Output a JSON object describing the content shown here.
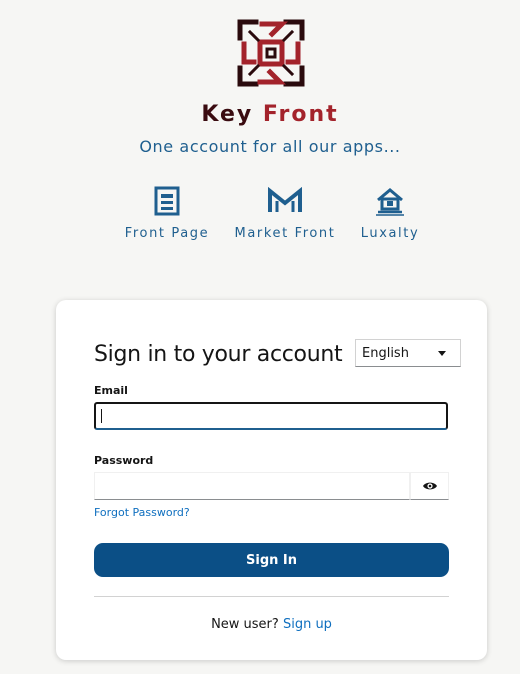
{
  "brand": {
    "name_part1": "Key",
    "name_part2": "Front",
    "tagline": "One account for all our apps..."
  },
  "apps": [
    {
      "label": "Front Page",
      "icon": "newspaper-icon"
    },
    {
      "label": "Market Front",
      "icon": "market-m-icon"
    },
    {
      "label": "Luxalty",
      "icon": "house-icon"
    }
  ],
  "login": {
    "title": "Sign in to your account",
    "language": "English",
    "email_label": "Email",
    "email_value": "",
    "password_label": "Password",
    "password_value": "",
    "forgot_password": "Forgot Password?",
    "sign_in_button": "Sign In",
    "new_user_text": "New user?",
    "sign_up_link": "Sign up"
  },
  "colors": {
    "brand_dark": "#3a0b10",
    "brand_red": "#a3232b",
    "accent_blue": "#1f5f8f",
    "button_blue": "#0b4f86",
    "link_blue": "#0f6fbf"
  }
}
